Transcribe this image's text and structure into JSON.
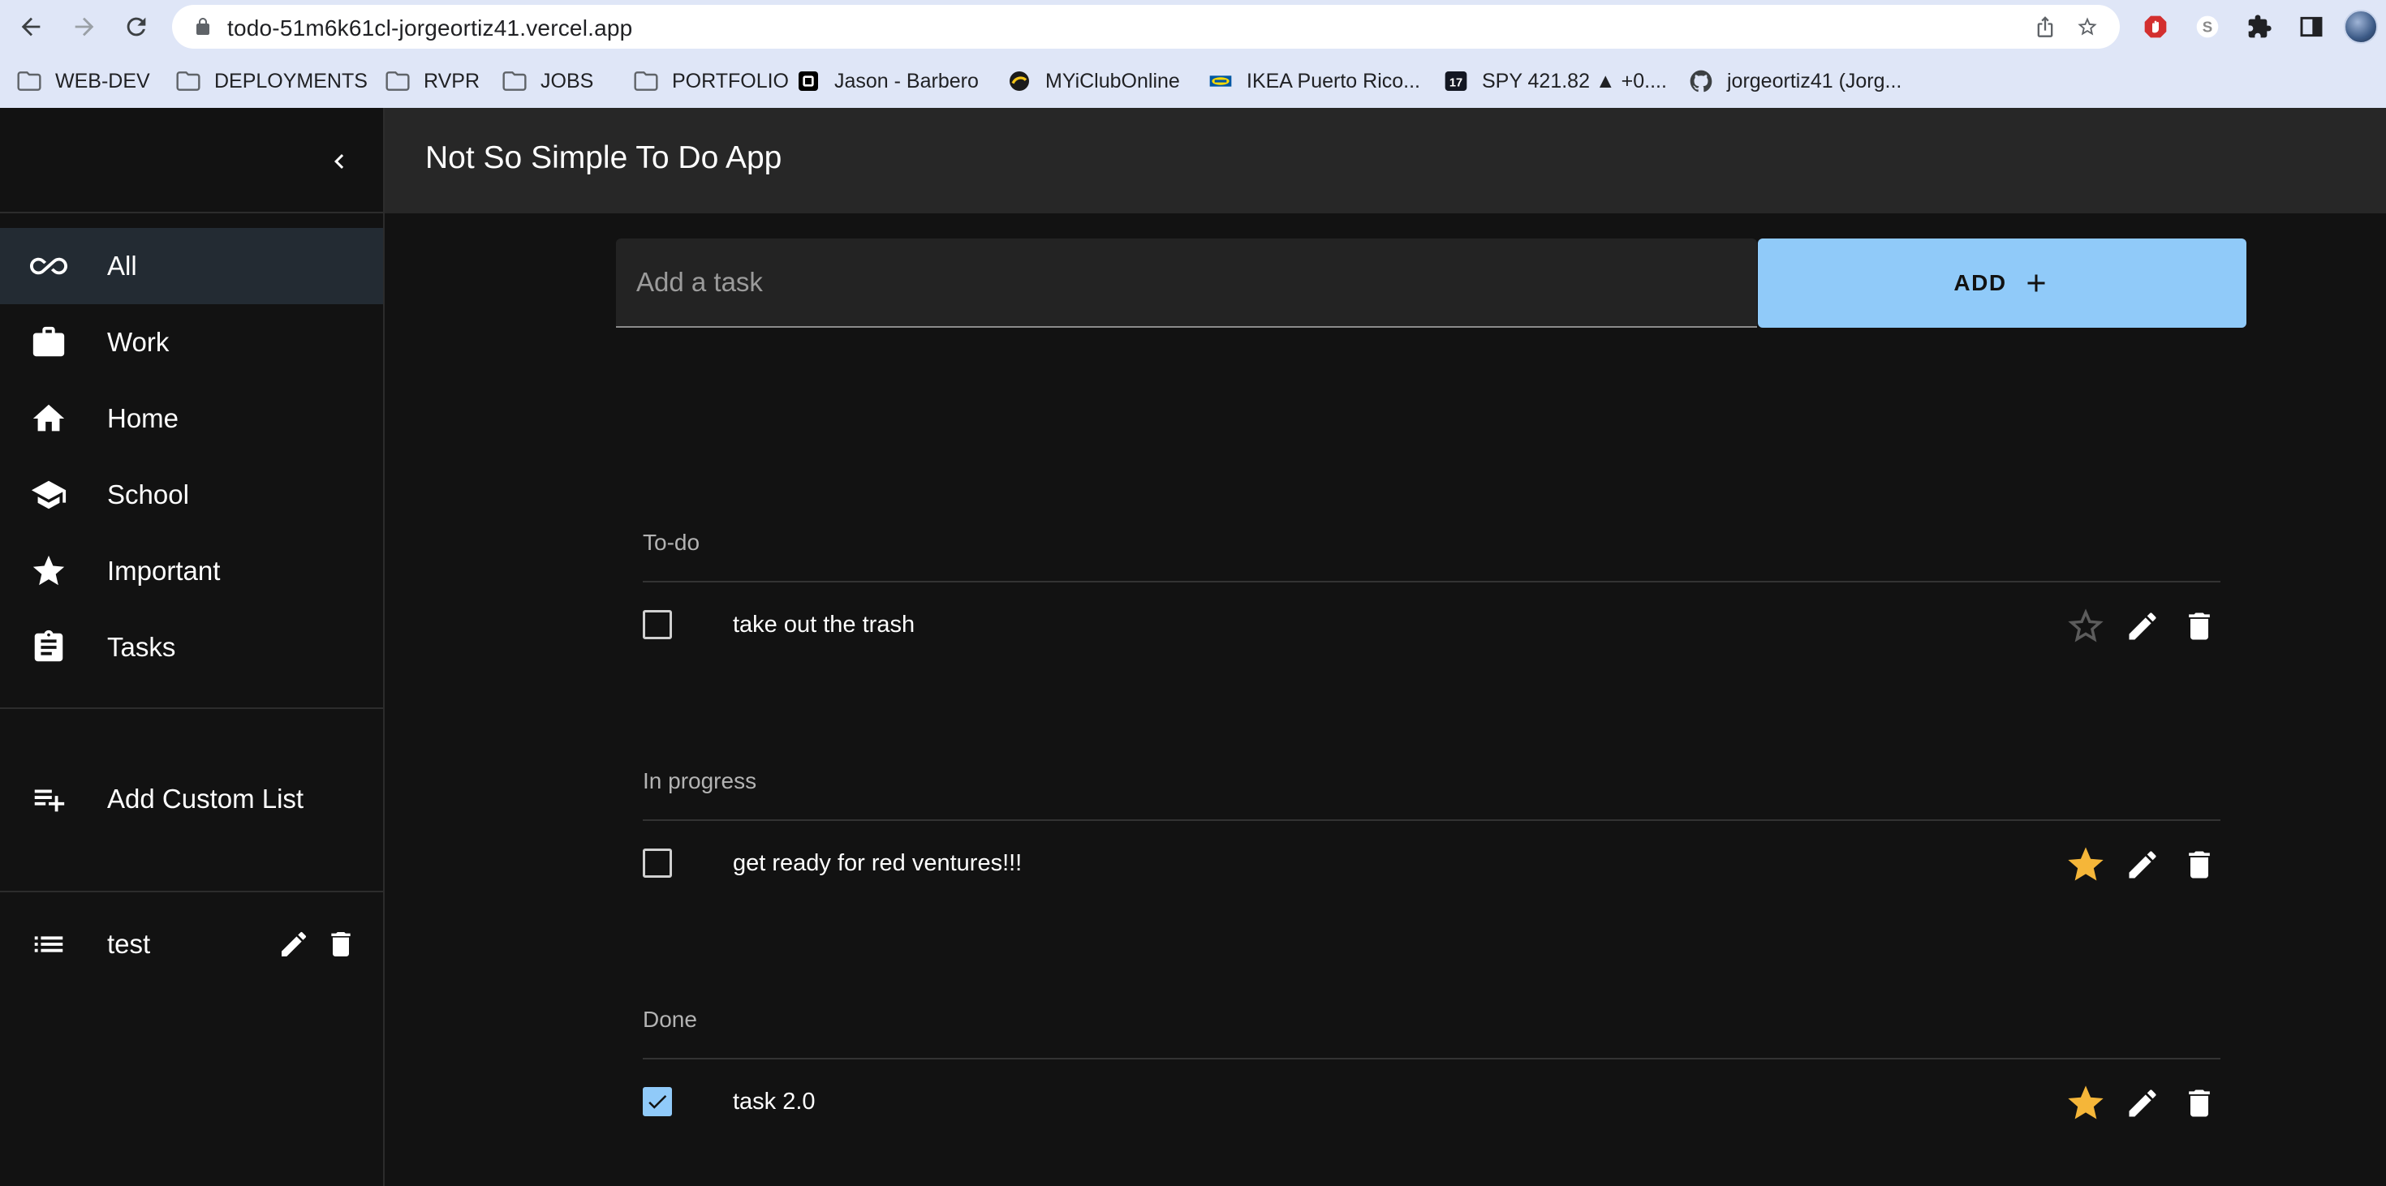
{
  "browser": {
    "url": "todo-51m6k61cl-jorgeortiz41.vercel.app",
    "bookmarks": [
      {
        "label": "WEB-DEV",
        "icon": "folder-icon"
      },
      {
        "label": "DEPLOYMENTS",
        "icon": "folder-icon"
      },
      {
        "label": "RVPR",
        "icon": "folder-icon"
      },
      {
        "label": "JOBS",
        "icon": "folder-icon"
      },
      {
        "label": "PORTFOLIO",
        "icon": "folder-icon"
      },
      {
        "label": "Jason - Barbero",
        "icon": "square-logo-icon"
      },
      {
        "label": "MYiClubOnline",
        "icon": "club-logo-icon"
      },
      {
        "label": "IKEA Puerto Rico...",
        "icon": "ikea-logo-icon"
      },
      {
        "label": "SPY 421.82 ▲ +0....",
        "icon": "tradingview-icon"
      },
      {
        "label": "jorgeortiz41 (Jorg...",
        "icon": "github-icon"
      }
    ]
  },
  "app": {
    "title": "Not So Simple To Do App",
    "sidebar": {
      "items": [
        {
          "label": "All",
          "icon": "infinity-icon",
          "active": true
        },
        {
          "label": "Work",
          "icon": "briefcase-icon"
        },
        {
          "label": "Home",
          "icon": "home-icon"
        },
        {
          "label": "School",
          "icon": "school-icon"
        },
        {
          "label": "Important",
          "icon": "star-icon"
        },
        {
          "label": "Tasks",
          "icon": "clipboard-icon"
        }
      ],
      "add_custom_list": "Add Custom List",
      "custom_lists": [
        {
          "label": "test",
          "icon": "list-icon"
        }
      ]
    },
    "add_task": {
      "placeholder": "Add a task",
      "value": "",
      "button_label": "ADD"
    },
    "sections": [
      {
        "title": "To-do",
        "tasks": [
          {
            "text": "take out the trash",
            "done": false,
            "important": false
          }
        ]
      },
      {
        "title": "In progress",
        "tasks": [
          {
            "text": "get ready for red ventures!!!",
            "done": false,
            "important": true
          }
        ]
      },
      {
        "title": "Done",
        "tasks": [
          {
            "text": "task 2.0",
            "done": true,
            "important": true
          }
        ]
      }
    ],
    "colors": {
      "accent": "#90caf9",
      "star": "#f5b639",
      "background": "#121212",
      "appbar": "#272727"
    }
  }
}
